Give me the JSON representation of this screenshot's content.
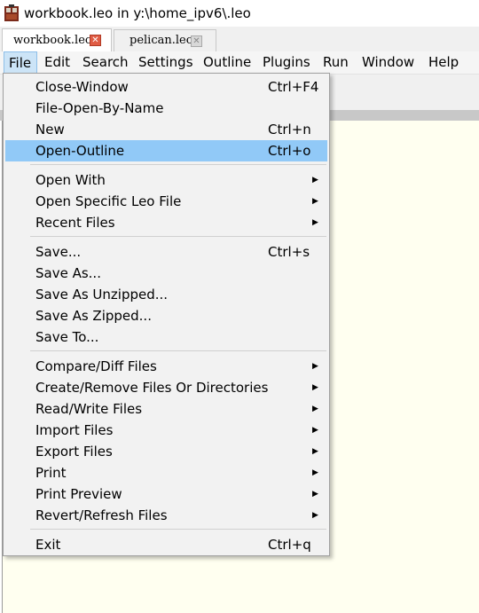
{
  "window": {
    "title": "workbook.leo in y:\\home_ipv6\\.leo",
    "icon": "leo-app-icon"
  },
  "tabs": [
    {
      "label": "workbook.leo",
      "active": true,
      "close": "✕"
    },
    {
      "label": "pelican.leo",
      "active": false,
      "close": "✕"
    }
  ],
  "menubar": [
    {
      "label": "File",
      "open": true
    },
    {
      "label": "Edit"
    },
    {
      "label": "Search"
    },
    {
      "label": "Settings"
    },
    {
      "label": "Outline"
    },
    {
      "label": "Plugins"
    },
    {
      "label": "Run"
    },
    {
      "label": "Window"
    },
    {
      "label": "Help"
    }
  ],
  "file_menu": {
    "items": [
      {
        "label": "Close-Window",
        "shortcut": "Ctrl+F4"
      },
      {
        "label": "File-Open-By-Name",
        "shortcut": ""
      },
      {
        "label": "New",
        "shortcut": "Ctrl+n"
      },
      {
        "label": "Open-Outline",
        "shortcut": "Ctrl+o",
        "highlighted": true
      },
      {
        "label": "Open With",
        "submenu": true
      },
      {
        "label": "Open Specific Leo File",
        "submenu": true
      },
      {
        "label": "Recent Files",
        "submenu": true
      },
      {
        "label": "Save...",
        "shortcut": "Ctrl+s"
      },
      {
        "label": "Save As..."
      },
      {
        "label": "Save As Unzipped..."
      },
      {
        "label": "Save As Zipped..."
      },
      {
        "label": "Save To..."
      },
      {
        "label": "Compare/Diff Files",
        "submenu": true
      },
      {
        "label": "Create/Remove Files Or Directories",
        "submenu": true
      },
      {
        "label": "Read/Write Files",
        "submenu": true
      },
      {
        "label": "Import Files",
        "submenu": true
      },
      {
        "label": "Export Files",
        "submenu": true
      },
      {
        "label": "Print",
        "submenu": true
      },
      {
        "label": "Print Preview",
        "submenu": true
      },
      {
        "label": "Revert/Refresh Files",
        "submenu": true
      },
      {
        "label": "Exit",
        "shortcut": "Ctrl+q"
      }
    ],
    "submenu_arrow": "▶"
  },
  "colors": {
    "highlight": "#91c9f7",
    "menu_open": "#cce4f7",
    "editor_bg": "#fffff0",
    "tab_close_active": "#e05c44"
  }
}
